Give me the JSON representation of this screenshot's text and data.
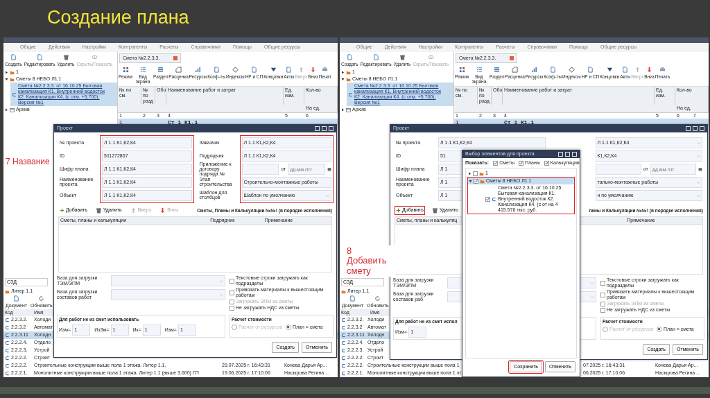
{
  "title": "Создание плана",
  "screens": [
    {
      "menu": [
        "Общие",
        "Действия",
        "Настройки",
        "Контрагенты",
        "Расчеты",
        "Справочники",
        "Помощь",
        "Общие ресурсы"
      ],
      "tree_toolbar": [
        {
          "label": "Создать",
          "disabled": false
        },
        {
          "label": "Редактировать",
          "disabled": false
        },
        {
          "label": "Удалить",
          "disabled": false
        },
        {
          "label": "Скрыть/Показать",
          "disabled": true
        }
      ],
      "tree": [
        {
          "label": "1",
          "expanded": false,
          "selected": false,
          "kind": "folder"
        },
        {
          "label": "Сметы 8 НЕБО Л1.1",
          "expanded": true,
          "selected": false,
          "kind": "folder",
          "children": [
            {
              "label": "Смета №2.2.3.3. от 16.10.25 Бытовая канализация К1. Внутренний водосток К2. Канализация К4. (с отм. +5.700). Версия №1",
              "selected": true,
              "kind": "estimate"
            }
          ]
        },
        {
          "label": "Архив",
          "expanded": false,
          "selected": false,
          "kind": "archive"
        }
      ],
      "tab": "Смета №2.2.3.3.",
      "ribbon": [
        {
          "label": "Режим",
          "disabled": false
        },
        {
          "label": "Вид экрана",
          "disabled": false
        },
        {
          "label": "Раздел",
          "disabled": false
        },
        {
          "label": "Расценка",
          "disabled": false
        },
        {
          "label": "Ресурсы",
          "disabled": false
        },
        {
          "label": "Коэф-ты",
          "disabled": false
        },
        {
          "label": "Индексы",
          "disabled": false
        },
        {
          "label": "НР и СП",
          "disabled": false
        },
        {
          "label": "Концовки",
          "disabled": false
        },
        {
          "label": "Акты",
          "disabled": false
        },
        {
          "label": "Вверх",
          "disabled": true
        },
        {
          "label": "Вниз",
          "disabled": false
        },
        {
          "label": "Печат",
          "disabled": false
        }
      ],
      "table": {
        "columns": [
          "№ по см.",
          "№ по разд",
          "Обо",
          "Наименование работ и затрат",
          "Ед. изм.",
          "Кол-во"
        ],
        "subcolumn": "На ед.",
        "numbers": [
          "1",
          "2",
          "3",
          "4",
          "5",
          "6"
        ],
        "section": {
          "number": "1",
          "title": "Ст 1_К1.1"
        }
      },
      "lower": {
        "search": "СЗД",
        "node": "Литер 1.1",
        "buttons": [
          "Документ",
          "Обновить"
        ],
        "columns": [
          "Код",
          "Имя"
        ],
        "rows": [
          {
            "code": "2.2.3.2.",
            "name": "Холоди",
            "date": "",
            "author": "",
            "selected": false
          },
          {
            "code": "2.2.3.2",
            "name": "Автомат",
            "date": "",
            "author": "",
            "selected": false
          },
          {
            "code": "2.2.3.11",
            "name": "Холодн",
            "date": "",
            "author": "",
            "selected": true
          },
          {
            "code": "2.2.2.4.",
            "name": "Отдело",
            "date": "",
            "author": "",
            "selected": false
          },
          {
            "code": "2.2.2.3.",
            "name": "Устрой",
            "date": "",
            "author": "",
            "selected": false
          },
          {
            "code": "2.2.2.2.",
            "name": "Строит",
            "date": "",
            "author": "",
            "selected": false
          },
          {
            "code": "2.2.2.2.",
            "name": "Строительные конструкции выше пола 1 этажа. Литер 1.1.",
            "date": "29.07.2025 г. 16:43:31",
            "author": "Конева Дарья Ар...",
            "selected": false
          },
          {
            "code": "2.2.2.1.",
            "name": "Монолитные конструкции выше пола 1 этажа. Литер 1.1 (выше 3.600) ГП",
            "date": "19.06.2025 г. 17:10:06",
            "author": "Насырова Регина ...",
            "selected": false
          }
        ]
      },
      "dialog": {
        "title": "Проект",
        "left_fields": {
          "highlighted": true,
          "items": [
            {
              "label": "№ проекта",
              "value": "Л 1.1 К1,К2,К4"
            },
            {
              "label": "ID",
              "value": "511272867"
            },
            {
              "label": "Шифр плана",
              "value": "Л 1.1 К1,К2,К4"
            },
            {
              "label": "Наименование проекта",
              "value": "Л 1.1 К1,К2,К4"
            },
            {
              "label": "Объект",
              "value": "Л 1.1 К1,К2,К4"
            }
          ]
        },
        "right_fields": {
          "highlighted": true,
          "items": [
            {
              "label": "Заказчик",
              "value": "Л 1.1 К1,К2,К4",
              "kind": "text"
            },
            {
              "label": "Подрядчик",
              "value": "Л 1.1 К1,К2,К4",
              "kind": "text"
            },
            {
              "label": "Приложение к договору подряда №",
              "value": "",
              "kind": "date",
              "date_label": "от",
              "date_placeholder": "дд.мм.гггг"
            },
            {
              "label": "Этап строительства",
              "value": "Строительно-монтажные работы",
              "kind": "text"
            },
            {
              "label": "Шаблон для столбцов",
              "value": "Шаблон по умолчанию",
              "kind": "select"
            }
          ]
        },
        "tools": [
          {
            "label": "Добавить",
            "disabled": false,
            "highlighted": false
          },
          {
            "label": "Удалить",
            "disabled": false,
            "highlighted": false
          },
          {
            "label": "Вверх",
            "disabled": true,
            "highlighted": false
          },
          {
            "label": "Вниз",
            "disabled": true,
            "highlighted": false
          }
        ],
        "list_heading": "Сметы, Планы и Калькуляции №№! (в порядке исполнения)",
        "list_columns": [
          "Сметы, планы и калькуляции",
          "Подрядчик",
          "Примечание"
        ],
        "bases": [
          "База для загрузки ТЭМ/ЭПМ",
          "База для загрузки составов работ"
        ],
        "options": [
          {
            "label": "Текстовые строки загружать как подразделы",
            "checked": false,
            "disabled": false
          },
          {
            "label": "Привязать материалы к вышестоящим работам",
            "checked": false,
            "disabled": false
          },
          {
            "label": "Загружать ЭПМ из сметы",
            "checked": false,
            "disabled": true
          },
          {
            "label": "Не загружать НДС из сметы",
            "checked": false,
            "disabled": false
          }
        ],
        "coef_group": "Для работ не из смет использовать",
        "coefs": [
          {
            "label": "Изм=",
            "value": "1"
          },
          {
            "label": "ИзЗм=",
            "value": "1"
          },
          {
            "label": "Ик=",
            "value": "1"
          },
          {
            "label": "Изм=",
            "value": "1"
          }
        ],
        "cost_group": "Расчет стоимости",
        "cost_options": [
          {
            "label": "Расчет от ресурсов",
            "selected": false,
            "disabled": true
          },
          {
            "label": "План = смета",
            "selected": true,
            "disabled": false
          }
        ],
        "buttons": [
          {
            "label": "Создать",
            "highlighted": false
          },
          {
            "label": "Отменить",
            "highlighted": false
          }
        ]
      },
      "annotation": "7 Название"
    },
    {
      "menu": [
        "Общие",
        "Действия",
        "Настройки",
        "Контрагенты",
        "Расчеты",
        "Справочники",
        "Помощь",
        "Общие ресурсы"
      ],
      "tree_toolbar": [
        {
          "label": "Создать",
          "disabled": false
        },
        {
          "label": "Редактировать",
          "disabled": false
        },
        {
          "label": "Удалить",
          "disabled": false
        },
        {
          "label": "Скрыть/Показать",
          "disabled": true
        }
      ],
      "tree": [
        {
          "label": "1",
          "expanded": false,
          "selected": false,
          "kind": "folder"
        },
        {
          "label": "Сметы 8 НЕБО Л1.1",
          "expanded": true,
          "selected": false,
          "kind": "folder",
          "children": [
            {
              "label": "Смета №2.2.3.3. от 16.10.25 Бытовая канализация К1. Внутренний водосток К2. Канализация К4. (с отм. +5.700). Версия №1",
              "selected": true,
              "kind": "estimate"
            }
          ]
        },
        {
          "label": "Архив",
          "expanded": false,
          "selected": false,
          "kind": "archive"
        }
      ],
      "tab": "Смета №2.2.3.3.",
      "ribbon": [
        {
          "label": "Режим",
          "disabled": false
        },
        {
          "label": "Вид экрана",
          "disabled": false
        },
        {
          "label": "Раздел",
          "disabled": false
        },
        {
          "label": "Расценка",
          "disabled": false
        },
        {
          "label": "Ресурсы",
          "disabled": false
        },
        {
          "label": "Коэф-ты",
          "disabled": false
        },
        {
          "label": "Индексы",
          "disabled": false
        },
        {
          "label": "НР и СП",
          "disabled": false
        },
        {
          "label": "Концовки",
          "disabled": false
        },
        {
          "label": "Акты",
          "disabled": false
        },
        {
          "label": "Вверх",
          "disabled": true
        },
        {
          "label": "Вниз",
          "disabled": false
        },
        {
          "label": "Печать",
          "disabled": false
        }
      ],
      "table": {
        "columns": [
          "№ по см.",
          "№ по разд",
          "Обо",
          "Наименование работ и затрат",
          "Ед. изм.",
          "Кол-во"
        ],
        "subcolumn": "На ед.",
        "numbers": [
          "1",
          "2",
          "3",
          "4",
          "5",
          "6",
          "7"
        ],
        "section": {
          "number": "1",
          "title": "Ст 1_К1.1"
        }
      },
      "lower": {
        "search": "СЗД",
        "node": "Литер 1.1",
        "buttons": [
          "Документ",
          "Обновить"
        ],
        "columns": [
          "Код",
          "Имя"
        ],
        "rows": [
          {
            "code": "2.2.3.2.",
            "name": "Холоди",
            "date": "",
            "author": "",
            "selected": false
          },
          {
            "code": "2.2.3.2",
            "name": "Автомат",
            "date": "",
            "author": "",
            "selected": false
          },
          {
            "code": "2.2.3.11",
            "name": "Холодн",
            "date": "",
            "author": "",
            "selected": true
          },
          {
            "code": "2.2.2.4.",
            "name": "Отдело",
            "date": "",
            "author": "",
            "selected": false
          },
          {
            "code": "2.2.2.3.",
            "name": "Устрой",
            "date": "",
            "author": "",
            "selected": false
          },
          {
            "code": "2.2.2.2.",
            "name": "Строит",
            "date": "",
            "author": "",
            "selected": false
          },
          {
            "code": "2.2.2.2.",
            "name": "Строительные конструкции выше пола 1",
            "date": "07.2025 г. 16:43:31",
            "author": "Конева Дарья Ар...",
            "selected": false
          },
          {
            "code": "2.2.2.1.",
            "name": "Монолитные конструкции выше пола 1 эт",
            "date": "06.2025 г. 17:10:06",
            "author": "Насырова Регина ...",
            "selected": false
          }
        ]
      },
      "dialog": {
        "title": "Проект",
        "left_fields": {
          "highlighted": false,
          "items": [
            {
              "label": "№ проекта",
              "value": "Л 1.1 К1,К2,К4"
            },
            {
              "label": "ID",
              "value": "51"
            },
            {
              "label": "Шифр плана",
              "value": "Л 1"
            },
            {
              "label": "Наименование проекта",
              "value": "Л 1"
            },
            {
              "label": "Объект",
              "value": "Л 1"
            }
          ]
        },
        "right_fields": {
          "highlighted": false,
          "items": [
            {
              "value": "Л 1.1 К1,К2,К4",
              "kind": "select"
            },
            {
              "value": "К1,К2,К4",
              "kind": "select"
            },
            {
              "value": "",
              "kind": "date",
              "date_label": "от",
              "date_placeholder": "дд.мм.гггг"
            },
            {
              "value": "тально-монтажные работы",
              "kind": "select"
            },
            {
              "value": "н по умолчанию",
              "kind": "select"
            }
          ]
        },
        "tools": [
          {
            "label": "Добавить",
            "disabled": false,
            "highlighted": true
          },
          {
            "label": "Удалить",
            "disabled": false,
            "highlighted": false
          }
        ],
        "list_heading": "ланы и Калькуляции №№! (в порядке исполнения)",
        "list_columns": [
          "Сметы, планы и калькуляц",
          "",
          "Примечание"
        ],
        "bases": [
          "База для загрузки ТЭМ/ЭПМ",
          "База для загрузки составов раб"
        ],
        "options": [
          {
            "label": "Текстовые строки загружать как подразделы",
            "checked": false,
            "disabled": false
          },
          {
            "label": "Привязать материалы к вышестоящим работам",
            "checked": false,
            "disabled": false
          },
          {
            "label": "Загружать ЭПМ из сметы",
            "checked": false,
            "disabled": true
          },
          {
            "label": "Не загружать НДС из сметы",
            "checked": false,
            "disabled": false
          }
        ],
        "coef_group": "Для работ не из смет испол",
        "coefs": [
          {
            "label": "Изм=",
            "value": "1"
          }
        ],
        "cost_group": "Расчет стоимости",
        "cost_options": [
          {
            "label": "Расчет от ресурсов",
            "selected": false,
            "disabled": true
          },
          {
            "label": "План = смета",
            "selected": true,
            "disabled": false
          }
        ],
        "buttons": [
          {
            "label": "Создать",
            "highlighted": false
          },
          {
            "label": "Отменить",
            "highlighted": false
          }
        ]
      },
      "picker": {
        "title": "Выбор элементов для проекта",
        "show_label": "Показать:",
        "filters": [
          {
            "label": "Сметы",
            "checked": true
          },
          {
            "label": "Планы",
            "checked": true
          },
          {
            "label": "Калькуляции",
            "checked": true
          }
        ],
        "tree": [
          {
            "label": "1",
            "expanded": false,
            "checked": false,
            "selected": false,
            "highlighted": false
          },
          {
            "label": "Сметы 8 НЕБО Л1.1",
            "expanded": true,
            "checked": true,
            "selected": true,
            "highlighted": true,
            "children": [
              {
                "label": "Смета №2.2.3.3. от 16.10.25 Бытовая канализация К1. Внутренний водосток К2. Канализация К4. (с от на 4 415.576 тыс. руб.",
                "checked": true
              }
            ]
          }
        ],
        "buttons": [
          {
            "label": "Сохранить",
            "highlighted": true
          },
          {
            "label": "Отменить",
            "highlighted": false
          }
        ]
      },
      "annotation": "8 Добавить смету"
    }
  ]
}
